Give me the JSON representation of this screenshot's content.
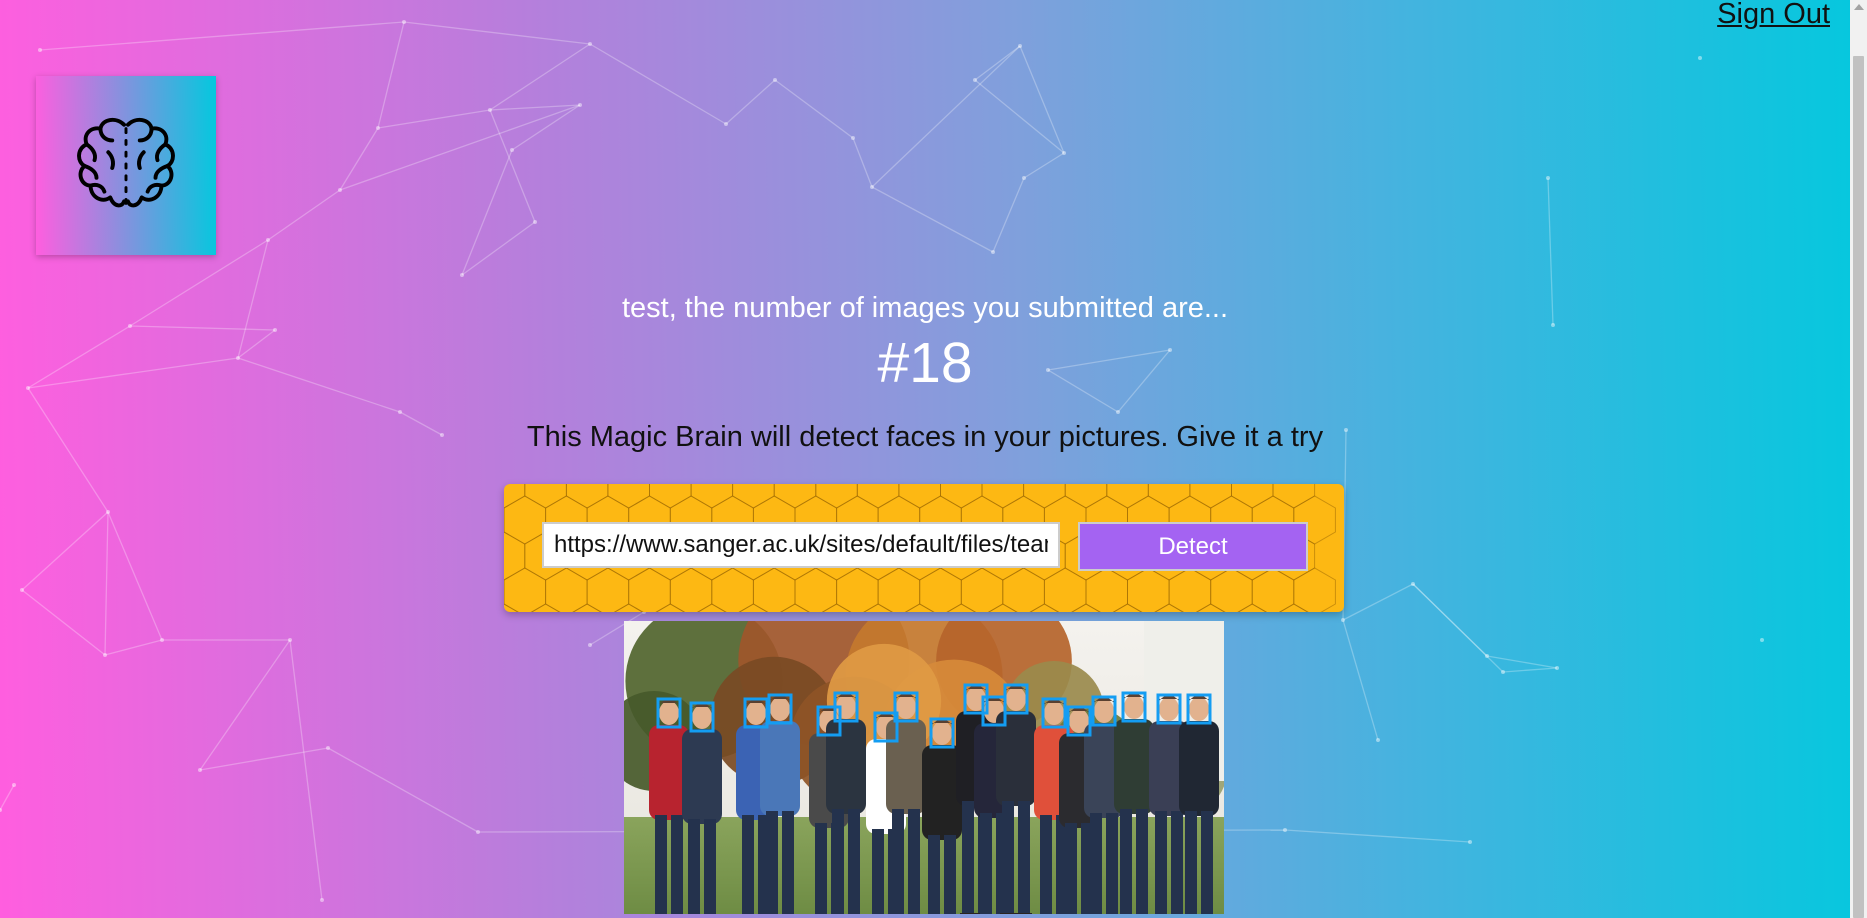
{
  "nav": {
    "sign_out_label": "Sign Out"
  },
  "logo": {
    "icon": "brain-icon"
  },
  "rank": {
    "welcome_text": "test, the number of images you submitted are...",
    "entries_value": "#18"
  },
  "intro": {
    "tagline": "This Magic Brain will detect faces in your pictures. Give it a try"
  },
  "image_form": {
    "url_value": "https://www.sanger.ac.uk/sites/default/files/team-photo.jpg",
    "detect_label": "Detect"
  },
  "result": {
    "icon": "group-photo",
    "detected_faces_count": 18
  },
  "colors": {
    "gradient_start": "#ff5edf",
    "gradient_end": "#04c8de",
    "panel_yellow": "#fdb813",
    "button_purple": "#a463f2",
    "face_box_blue": "#149df2"
  }
}
